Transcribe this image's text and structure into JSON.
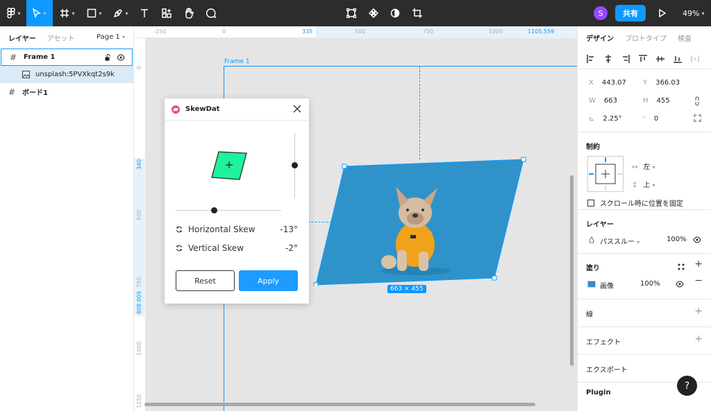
{
  "toolbar": {
    "avatar_initial": "S",
    "share_label": "共有",
    "zoom": "49%"
  },
  "left_panel": {
    "tabs": [
      "レイヤー",
      "アセット"
    ],
    "page": "Page 1",
    "layers": [
      {
        "name": "Frame 1"
      },
      {
        "name": "unsplash:5PVXkqt2s9k"
      },
      {
        "name": "ボード1"
      }
    ]
  },
  "canvas": {
    "ruler_top": [
      "-250",
      "0",
      "335",
      "500",
      "750",
      "1000",
      "1105.559"
    ],
    "ruler_left": [
      "0",
      "340",
      "500",
      "750",
      "808.009",
      "1000",
      "1250"
    ],
    "frame_label": "Frame 1",
    "dimensions": "663 × 455"
  },
  "plugin": {
    "title": "SkewDat",
    "horizontal_label": "Horizontal Skew",
    "horizontal_value": "-13°",
    "vertical_label": "Vertical Skew",
    "vertical_value": "-2°",
    "reset_label": "Reset",
    "apply_label": "Apply"
  },
  "right_panel": {
    "tabs": [
      "デザイン",
      "プロトタイプ",
      "検査"
    ],
    "x": "443.07",
    "y": "366.03",
    "w": "663",
    "h": "455",
    "rotation": "2.25°",
    "radius": "0",
    "constraints_title": "制約",
    "constraint_h": "左",
    "constraint_v": "上",
    "fix_scroll_label": "スクロール時に位置を固定",
    "layer_title": "レイヤー",
    "blend_mode": "パススルー",
    "layer_opacity": "100%",
    "fill_title": "塗り",
    "fill_type": "画像",
    "fill_opacity": "100%",
    "stroke_title": "線",
    "effect_title": "エフェクト",
    "export_title": "エクスポート",
    "plugin_title": "Plugin"
  },
  "colors": {
    "accent": "#0d99ff",
    "toolbar_bg": "#2c2c2c",
    "skew_shape": "#1ef29a",
    "photo_bg": "#2e8fc4"
  }
}
